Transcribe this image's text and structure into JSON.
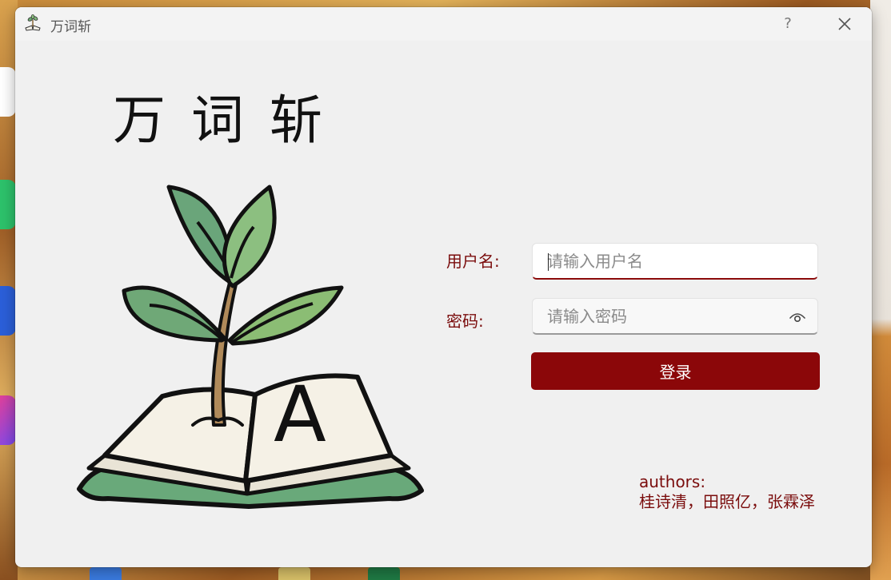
{
  "window": {
    "title": "万词斩",
    "help_label": "?"
  },
  "app": {
    "heading": "万词斩"
  },
  "form": {
    "username_label": "用户名:",
    "username_placeholder": "请输入用户名",
    "password_label": "密码:",
    "password_placeholder": "请输入密码",
    "login_label": "登录"
  },
  "credits": {
    "label": "authors:",
    "names": "桂诗清，田照亿，张霖泽"
  },
  "logo": {
    "letter": "A"
  },
  "colors": {
    "accent": "#8b0709",
    "label_text": "#7a0c0c",
    "window_bg": "#f0f0f0"
  },
  "icons": {
    "title": "sprout-book-icon",
    "close": "close-icon",
    "password_toggle": "eye-icon"
  }
}
